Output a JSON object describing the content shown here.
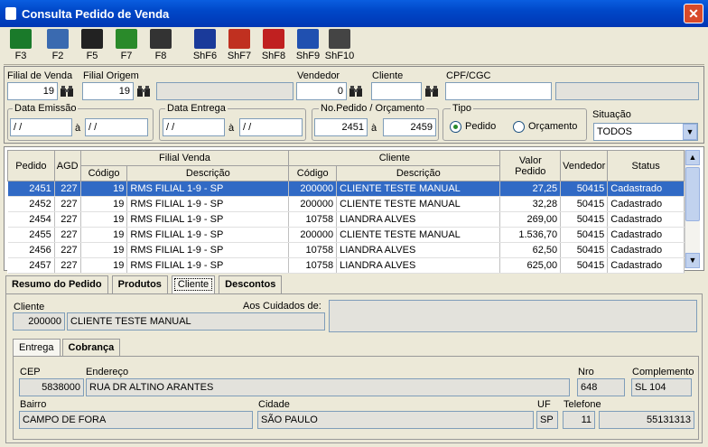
{
  "window": {
    "title": "Consulta Pedido de Venda",
    "close": "✕"
  },
  "toolbar": [
    {
      "key": "F3",
      "icon": "exit-door-icon"
    },
    {
      "key": "F2",
      "icon": "calculator-print-icon"
    },
    {
      "key": "F5",
      "icon": "document-copy-icon"
    },
    {
      "key": "F7",
      "icon": "chart-icon"
    },
    {
      "key": "F8",
      "icon": "printer-icon"
    },
    {
      "key": "ShF6",
      "icon": "floppy-disk-icon"
    },
    {
      "key": "ShF7",
      "icon": "truck-icon"
    },
    {
      "key": "ShF8",
      "icon": "check-mail-icon"
    },
    {
      "key": "ShF9",
      "icon": "monitor-icon"
    },
    {
      "key": "ShF10",
      "icon": "lock-icon"
    }
  ],
  "filters": {
    "filial_venda": {
      "label": "Filial de Venda",
      "value": "19"
    },
    "filial_origem": {
      "label": "Filial Origem",
      "value": "19"
    },
    "vendedor": {
      "label": "Vendedor",
      "value": "0"
    },
    "cliente": {
      "label": "Cliente",
      "value": ""
    },
    "cpf": {
      "label": "CPF/CGC",
      "value": ""
    },
    "data_emissao": {
      "label": "Data Emissão",
      "from": " / /",
      "to": " / /"
    },
    "data_entrega": {
      "label": "Data Entrega",
      "from": " / /",
      "to": " / /"
    },
    "no_pedido": {
      "label": "No.Pedido / Orçamento",
      "from": "2451",
      "to": "2459"
    },
    "range_sep": "à",
    "tipo": {
      "label": "Tipo",
      "pedido": "Pedido",
      "orcamento": "Orçamento"
    },
    "situacao": {
      "label": "Situação",
      "value": "TODOS"
    }
  },
  "grid": {
    "headers": {
      "pedido": "Pedido",
      "agd": "AGD",
      "filial": "Filial Venda",
      "cliente": "Cliente",
      "codigo": "Código",
      "descricao": "Descrição",
      "valor": "Valor Pedido",
      "vendedor": "Vendedor",
      "status": "Status"
    },
    "rows": [
      {
        "pedido": "2451",
        "agd": "227",
        "fcod": "19",
        "fdesc": "RMS FILIAL 1-9 - SP",
        "ccod": "200000",
        "cdesc": "CLIENTE TESTE MANUAL",
        "valor": "27,25",
        "vend": "50415",
        "status": "Cadastrado"
      },
      {
        "pedido": "2452",
        "agd": "227",
        "fcod": "19",
        "fdesc": "RMS FILIAL 1-9 - SP",
        "ccod": "200000",
        "cdesc": "CLIENTE TESTE MANUAL",
        "valor": "32,28",
        "vend": "50415",
        "status": "Cadastrado"
      },
      {
        "pedido": "2454",
        "agd": "227",
        "fcod": "19",
        "fdesc": "RMS FILIAL 1-9 - SP",
        "ccod": "10758",
        "cdesc": "LIANDRA ALVES",
        "valor": "269,00",
        "vend": "50415",
        "status": "Cadastrado"
      },
      {
        "pedido": "2455",
        "agd": "227",
        "fcod": "19",
        "fdesc": "RMS FILIAL 1-9 - SP",
        "ccod": "200000",
        "cdesc": "CLIENTE TESTE MANUAL",
        "valor": "1.536,70",
        "vend": "50415",
        "status": "Cadastrado"
      },
      {
        "pedido": "2456",
        "agd": "227",
        "fcod": "19",
        "fdesc": "RMS FILIAL 1-9 - SP",
        "ccod": "10758",
        "cdesc": "LIANDRA ALVES",
        "valor": "62,50",
        "vend": "50415",
        "status": "Cadastrado"
      },
      {
        "pedido": "2457",
        "agd": "227",
        "fcod": "19",
        "fdesc": "RMS FILIAL 1-9 - SP",
        "ccod": "10758",
        "cdesc": "LIANDRA ALVES",
        "valor": "625,00",
        "vend": "50415",
        "status": "Cadastrado"
      }
    ]
  },
  "tabs": [
    "Resumo do Pedido",
    "Produtos",
    "Cliente",
    "Descontos"
  ],
  "cliente_tab": {
    "label": "Cliente",
    "codigo": "200000",
    "nome": "CLIENTE TESTE MANUAL",
    "aos_label": "Aos Cuidados de:",
    "aos_value": ""
  },
  "subtabs": [
    "Entrega",
    "Cobrança"
  ],
  "entrega": {
    "cep_label": "CEP",
    "cep": "5838000",
    "end_label": "Endereço",
    "end": "RUA DR ALTINO ARANTES",
    "nro_label": "Nro",
    "nro": "648",
    "comp_label": "Complemento",
    "comp": "SL 104",
    "bairro_label": "Bairro",
    "bairro": "CAMPO DE FORA",
    "cidade_label": "Cidade",
    "cidade": "SÃO PAULO",
    "uf_label": "UF",
    "uf": "SP",
    "tel_label": "Telefone",
    "ddd": "11",
    "tel": "55131313"
  }
}
